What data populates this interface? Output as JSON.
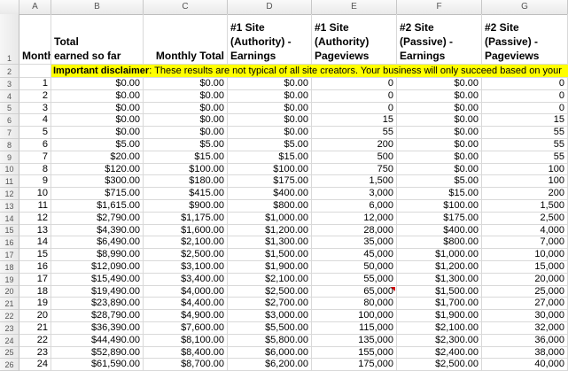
{
  "columns": [
    "A",
    "B",
    "C",
    "D",
    "E",
    "F",
    "G"
  ],
  "header": {
    "row_label": "1",
    "a": [
      "Month"
    ],
    "b": [
      "Total",
      "earned so far"
    ],
    "c": [
      "Monthly Total"
    ],
    "d": [
      "#1 Site",
      "(Authority) -",
      "Earnings"
    ],
    "e": [
      "#1 Site",
      "(Authority)",
      "Pageviews"
    ],
    "f": [
      "#2 Site",
      "(Passive) -",
      "Earnings"
    ],
    "g": [
      "#2 Site",
      "(Passive) -",
      "Pageviews"
    ]
  },
  "disclaimer": {
    "row_label": "2",
    "label": "Important disclaimer",
    "text": ": These results are not typical of all site creators.  Your business will only succeed based on your"
  },
  "rows": [
    {
      "row": "3",
      "month": "1",
      "total": "$0.00",
      "monthly": "$0.00",
      "d": "$0.00",
      "e": "0",
      "f": "$0.00",
      "g": "0"
    },
    {
      "row": "4",
      "month": "2",
      "total": "$0.00",
      "monthly": "$0.00",
      "d": "$0.00",
      "e": "0",
      "f": "$0.00",
      "g": "0"
    },
    {
      "row": "5",
      "month": "3",
      "total": "$0.00",
      "monthly": "$0.00",
      "d": "$0.00",
      "e": "0",
      "f": "$0.00",
      "g": "0"
    },
    {
      "row": "6",
      "month": "4",
      "total": "$0.00",
      "monthly": "$0.00",
      "d": "$0.00",
      "e": "15",
      "f": "$0.00",
      "g": "15"
    },
    {
      "row": "7",
      "month": "5",
      "total": "$0.00",
      "monthly": "$0.00",
      "d": "$0.00",
      "e": "55",
      "f": "$0.00",
      "g": "55"
    },
    {
      "row": "8",
      "month": "6",
      "total": "$5.00",
      "monthly": "$5.00",
      "d": "$5.00",
      "e": "200",
      "f": "$0.00",
      "g": "55"
    },
    {
      "row": "9",
      "month": "7",
      "total": "$20.00",
      "monthly": "$15.00",
      "d": "$15.00",
      "e": "500",
      "f": "$0.00",
      "g": "55"
    },
    {
      "row": "10",
      "month": "8",
      "total": "$120.00",
      "monthly": "$100.00",
      "d": "$100.00",
      "e": "750",
      "f": "$0.00",
      "g": "100"
    },
    {
      "row": "11",
      "month": "9",
      "total": "$300.00",
      "monthly": "$180.00",
      "d": "$175.00",
      "e": "1,500",
      "f": "$5.00",
      "g": "100"
    },
    {
      "row": "12",
      "month": "10",
      "total": "$715.00",
      "monthly": "$415.00",
      "d": "$400.00",
      "e": "3,000",
      "f": "$15.00",
      "g": "200"
    },
    {
      "row": "13",
      "month": "11",
      "total": "$1,615.00",
      "monthly": "$900.00",
      "d": "$800.00",
      "e": "6,000",
      "f": "$100.00",
      "g": "1,500"
    },
    {
      "row": "14",
      "month": "12",
      "total": "$2,790.00",
      "monthly": "$1,175.00",
      "d": "$1,000.00",
      "e": "12,000",
      "f": "$175.00",
      "g": "2,500"
    },
    {
      "row": "15",
      "month": "13",
      "total": "$4,390.00",
      "monthly": "$1,600.00",
      "d": "$1,200.00",
      "e": "28,000",
      "f": "$400.00",
      "g": "4,000"
    },
    {
      "row": "16",
      "month": "14",
      "total": "$6,490.00",
      "monthly": "$2,100.00",
      "d": "$1,300.00",
      "e": "35,000",
      "f": "$800.00",
      "g": "7,000"
    },
    {
      "row": "17",
      "month": "15",
      "total": "$8,990.00",
      "monthly": "$2,500.00",
      "d": "$1,500.00",
      "e": "45,000",
      "f": "$1,000.00",
      "g": "10,000"
    },
    {
      "row": "18",
      "month": "16",
      "total": "$12,090.00",
      "monthly": "$3,100.00",
      "d": "$1,900.00",
      "e": "50,000",
      "f": "$1,200.00",
      "g": "15,000"
    },
    {
      "row": "19",
      "month": "17",
      "total": "$15,490.00",
      "monthly": "$3,400.00",
      "d": "$2,100.00",
      "e": "55,000",
      "f": "$1,300.00",
      "g": "20,000"
    },
    {
      "row": "20",
      "month": "18",
      "total": "$19,490.00",
      "monthly": "$4,000.00",
      "d": "$2,500.00",
      "e": "65,000",
      "f": "$1,500.00",
      "g": "25,000",
      "e_comment": true
    },
    {
      "row": "21",
      "month": "19",
      "total": "$23,890.00",
      "monthly": "$4,400.00",
      "d": "$2,700.00",
      "e": "80,000",
      "f": "$1,700.00",
      "g": "27,000"
    },
    {
      "row": "22",
      "month": "20",
      "total": "$28,790.00",
      "monthly": "$4,900.00",
      "d": "$3,000.00",
      "e": "100,000",
      "f": "$1,900.00",
      "g": "30,000"
    },
    {
      "row": "23",
      "month": "21",
      "total": "$36,390.00",
      "monthly": "$7,600.00",
      "d": "$5,500.00",
      "e": "115,000",
      "f": "$2,100.00",
      "g": "32,000"
    },
    {
      "row": "24",
      "month": "22",
      "total": "$44,490.00",
      "monthly": "$8,100.00",
      "d": "$5,800.00",
      "e": "135,000",
      "f": "$2,300.00",
      "g": "36,000"
    },
    {
      "row": "25",
      "month": "23",
      "total": "$52,890.00",
      "monthly": "$8,400.00",
      "d": "$6,000.00",
      "e": "155,000",
      "f": "$2,400.00",
      "g": "38,000"
    },
    {
      "row": "26",
      "month": "24",
      "total": "$61,590.00",
      "monthly": "$8,700.00",
      "d": "$6,200.00",
      "e": "175,000",
      "f": "$2,500.00",
      "g": "40,000"
    }
  ]
}
